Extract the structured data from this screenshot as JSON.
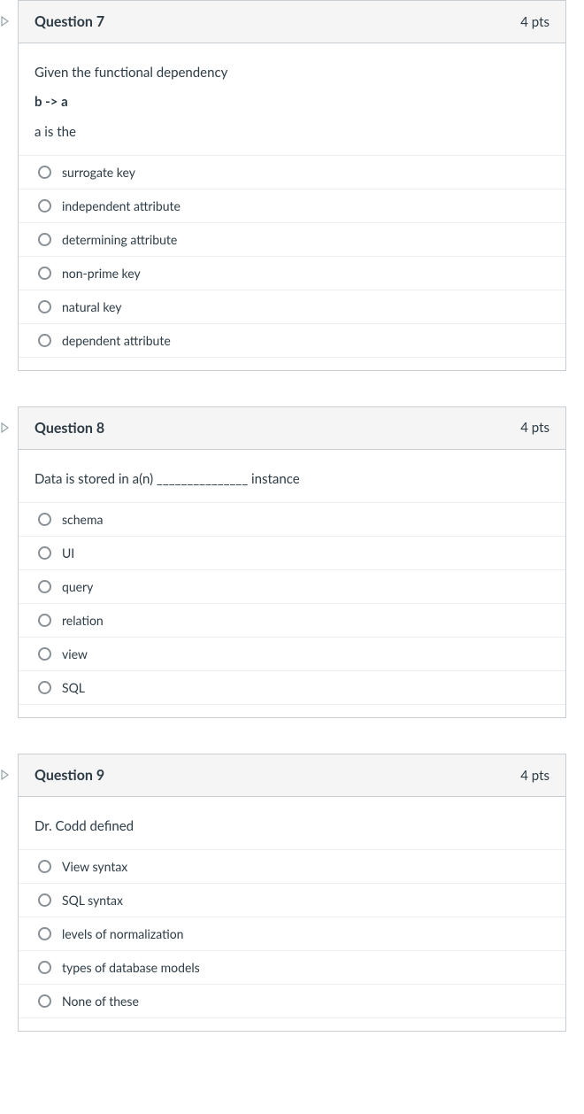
{
  "questions": [
    {
      "number_label": "Question 7",
      "points_label": "4 pts",
      "body_lines": [
        {
          "text": "Given the functional dependency",
          "bold": false
        },
        {
          "text": "b -> a",
          "bold": true
        },
        {
          "text": "a is the",
          "bold": false
        }
      ],
      "answers": [
        "surrogate key",
        "independent attribute",
        "determining attribute",
        "non-prime key",
        "natural key",
        "dependent attribute"
      ]
    },
    {
      "number_label": "Question 8",
      "points_label": "4 pts",
      "body_lines": [
        {
          "text": "Data is stored in a(n) _______________ instance",
          "bold": false
        }
      ],
      "answers": [
        "schema",
        "UI",
        "query",
        "relation",
        "view",
        "SQL"
      ]
    },
    {
      "number_label": "Question 9",
      "points_label": "4 pts",
      "body_lines": [
        {
          "text": "Dr. Codd defined",
          "bold": false
        }
      ],
      "answers": [
        "View syntax",
        "SQL syntax",
        "levels of normalization",
        "types of database models",
        "None of these"
      ]
    }
  ]
}
